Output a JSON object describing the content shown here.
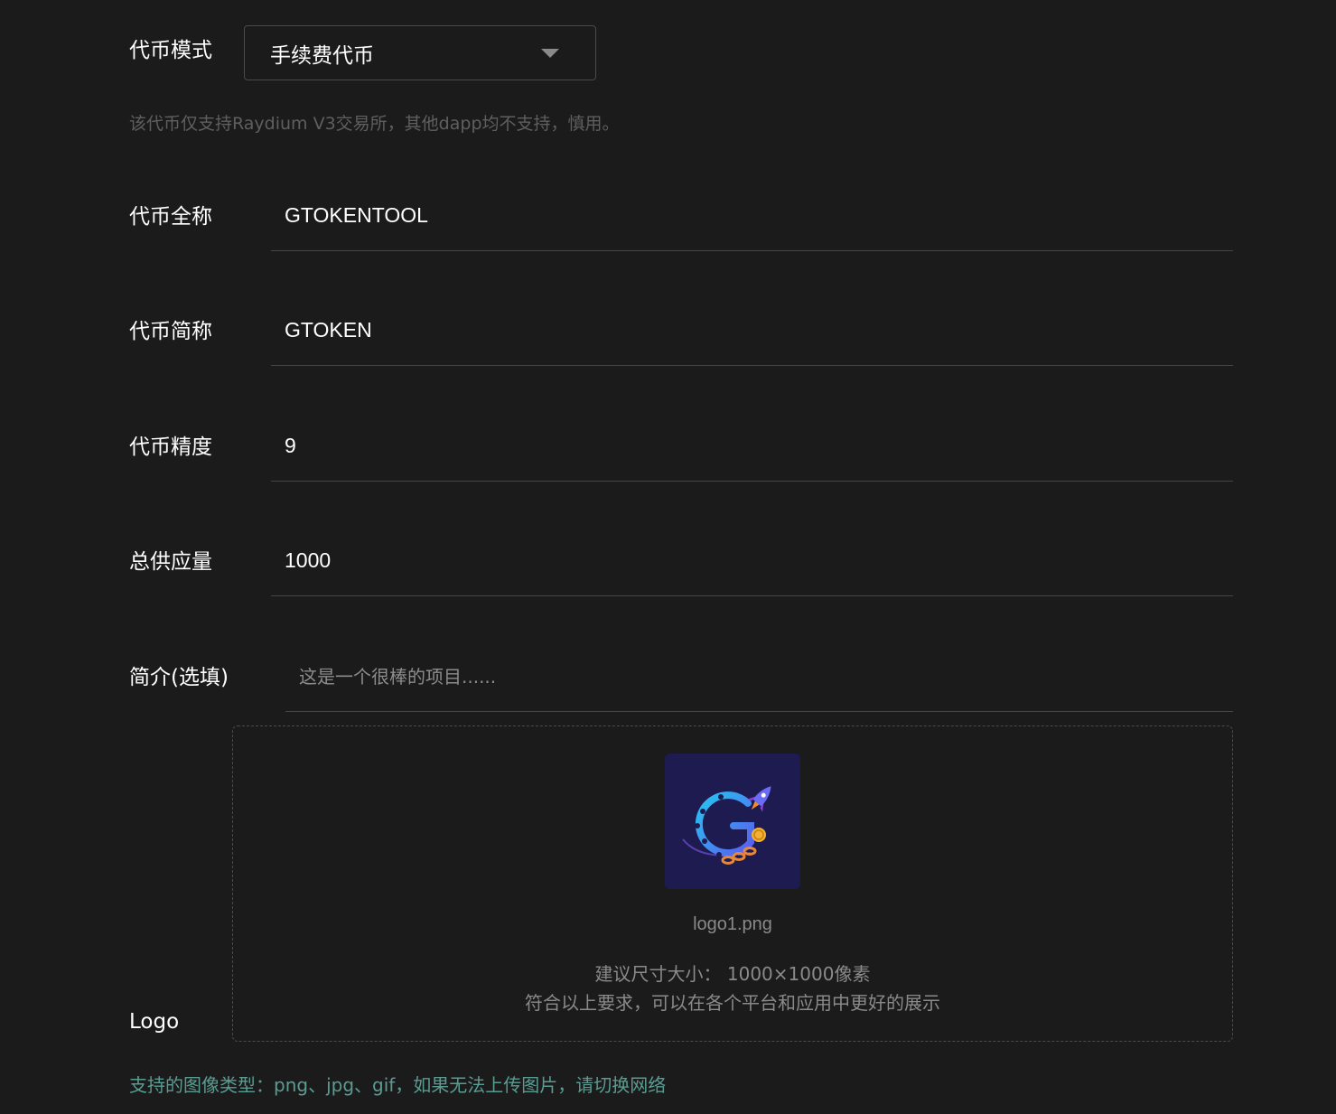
{
  "mode": {
    "label": "代币模式",
    "selected": "手续费代币",
    "hint": "该代币仅支持Raydium V3交易所，其他dapp均不支持，慎用。"
  },
  "fields": {
    "full_name": {
      "label": "代币全称",
      "value": "GTOKENTOOL"
    },
    "symbol": {
      "label": "代币简称",
      "value": "GTOKEN"
    },
    "decimals": {
      "label": "代币精度",
      "value": "9"
    },
    "supply": {
      "label": "总供应量",
      "value": "1000"
    },
    "description": {
      "label": "简介(选填)",
      "value": "",
      "placeholder": "这是一个很棒的项目......"
    }
  },
  "logo": {
    "label": "Logo",
    "filename": "logo1.png",
    "size_hint": "建议尺寸大小： 1000×1000像素",
    "fit_hint": "符合以上要求，可以在各个平台和应用中更好的展示"
  },
  "types_hint": "支持的图像类型：png、jpg、gif，如果无法上传图片，请切换网络",
  "colors": {
    "background": "#1b1b1b",
    "accent_hint": "#5a9c92",
    "logo_bg": "#1d1b4f"
  }
}
